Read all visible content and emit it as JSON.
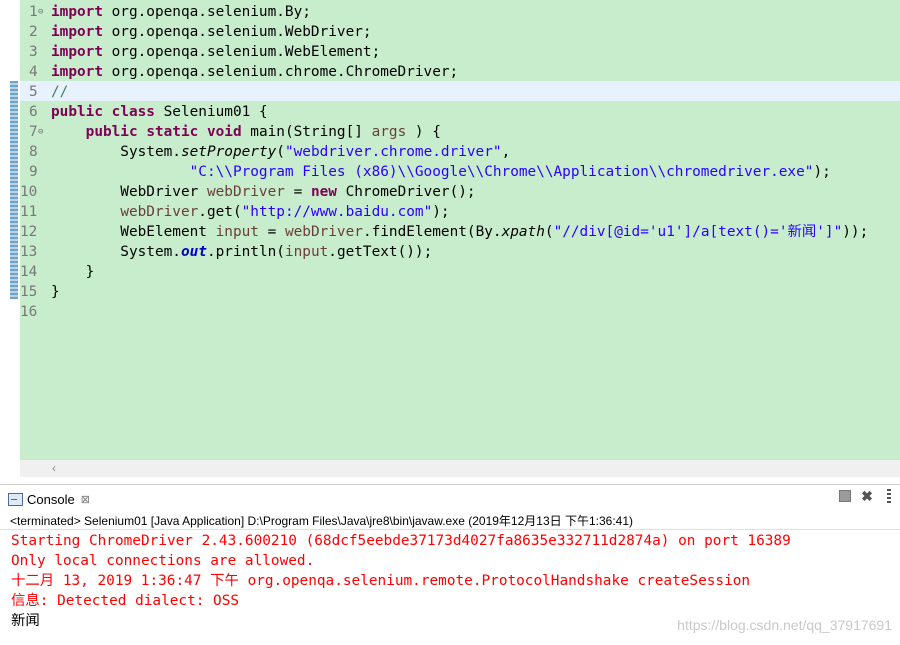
{
  "editor": {
    "lines": [
      {
        "n": "1",
        "fold": "⊖",
        "tokens": [
          [
            "kw",
            "import"
          ],
          [
            "",
            "  org.openqa.selenium.By;"
          ]
        ]
      },
      {
        "n": "2",
        "tokens": [
          [
            "kw",
            "import"
          ],
          [
            "",
            "  org.openqa.selenium.WebDriver;"
          ]
        ]
      },
      {
        "n": "3",
        "tokens": [
          [
            "kw",
            "import"
          ],
          [
            "",
            "  org.openqa.selenium.WebElement;"
          ]
        ]
      },
      {
        "n": "4",
        "tokens": [
          [
            "kw",
            "import"
          ],
          [
            "",
            "  org.openqa.selenium.chrome.ChromeDriver;"
          ]
        ]
      },
      {
        "n": "5",
        "tokens": [
          [
            "cm",
            "//"
          ]
        ]
      },
      {
        "n": "6",
        "tokens": [
          [
            "kw",
            "public"
          ],
          [
            "",
            " "
          ],
          [
            "kw",
            "class"
          ],
          [
            "",
            " Selenium01 {"
          ]
        ]
      },
      {
        "n": "7",
        "fold": "⊖",
        "tokens": [
          [
            "",
            "    "
          ],
          [
            "kw",
            "public"
          ],
          [
            "",
            " "
          ],
          [
            "kw",
            "static"
          ],
          [
            "",
            " "
          ],
          [
            "kw",
            "void"
          ],
          [
            "",
            " main(String[] "
          ],
          [
            "var",
            "args"
          ],
          [
            "",
            " ) {"
          ]
        ]
      },
      {
        "n": "8",
        "tokens": [
          [
            "",
            "        System."
          ],
          [
            "mth",
            "setProperty"
          ],
          [
            "",
            "("
          ],
          [
            "str",
            "\"webdriver.chrome.driver\""
          ],
          [
            "",
            ","
          ]
        ]
      },
      {
        "n": "9",
        "tokens": [
          [
            "",
            "                "
          ],
          [
            "str",
            "\"C:\\\\Program Files (x86)\\\\Google\\\\Chrome\\\\Application\\\\chromedriver.exe\""
          ],
          [
            "",
            ");"
          ]
        ]
      },
      {
        "n": "10",
        "tokens": [
          [
            "",
            "        WebDriver "
          ],
          [
            "var",
            "webDriver"
          ],
          [
            "",
            " = "
          ],
          [
            "kw",
            "new"
          ],
          [
            "",
            " ChromeDriver();"
          ]
        ]
      },
      {
        "n": "11",
        "tokens": [
          [
            "",
            "        "
          ],
          [
            "var",
            "webDriver"
          ],
          [
            "",
            ".get("
          ],
          [
            "str",
            "\"http://www.baidu.com\""
          ],
          [
            "",
            ");"
          ]
        ]
      },
      {
        "n": "12",
        "tokens": [
          [
            "",
            "        WebElement "
          ],
          [
            "var",
            "input"
          ],
          [
            "",
            " = "
          ],
          [
            "var",
            "webDriver"
          ],
          [
            "",
            ".findElement(By."
          ],
          [
            "mth",
            "xpath"
          ],
          [
            "",
            "("
          ],
          [
            "str",
            "\"//div[@id='u1']/a[text()='新闻']\""
          ],
          [
            "",
            "));"
          ]
        ]
      },
      {
        "n": "13",
        "tokens": [
          [
            "",
            "        System."
          ],
          [
            "fld",
            "out"
          ],
          [
            "",
            ".println("
          ],
          [
            "var",
            "input"
          ],
          [
            "",
            ".getText());"
          ]
        ]
      },
      {
        "n": "14",
        "tokens": [
          [
            "",
            "    }"
          ]
        ]
      },
      {
        "n": "15",
        "tokens": [
          [
            "",
            "}"
          ]
        ]
      },
      {
        "n": "16",
        "tokens": []
      }
    ]
  },
  "console": {
    "tab_label": "Console",
    "tab_close": "⊠",
    "header": "<terminated> Selenium01 [Java Application] D:\\Program Files\\Java\\jre8\\bin\\javaw.exe (2019年12月13日 下午1:36:41)",
    "output": [
      {
        "style": "err",
        "text": "Starting ChromeDriver 2.43.600210 (68dcf5eebde37173d4027fa8635e332711d2874a) on port 16389"
      },
      {
        "style": "err",
        "text": "Only local connections are allowed."
      },
      {
        "style": "err",
        "text": "十二月 13, 2019 1:36:47 下午 org.openqa.selenium.remote.ProtocolHandshake createSession"
      },
      {
        "style": "err",
        "text": "信息: Detected dialect: OSS"
      },
      {
        "style": "std",
        "text": "新闻"
      }
    ]
  },
  "watermark": "https://blog.csdn.net/qq_37917691",
  "icons": {
    "console": "console-icon",
    "terminate": "terminate-icon",
    "remove": "remove-launch-icon",
    "more": "more-icon"
  },
  "colors": {
    "editor_bg": "#c7edcc",
    "keyword": "#7f0055",
    "string": "#2a00ff",
    "error_output": "#ff0000"
  }
}
